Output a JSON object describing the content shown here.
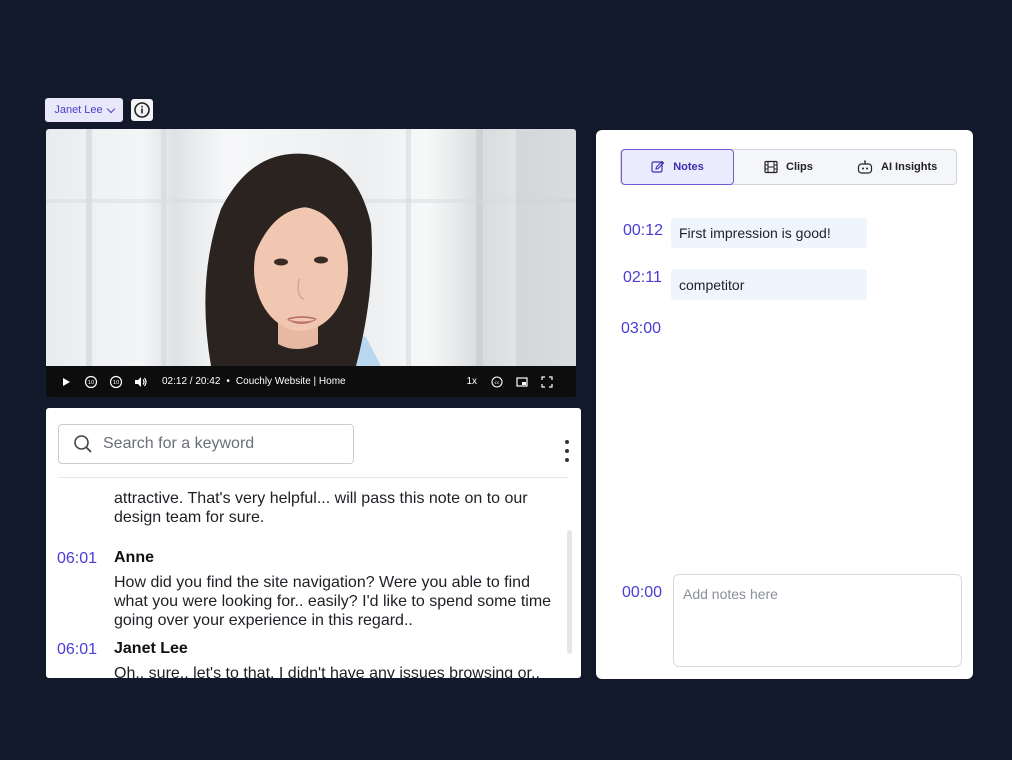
{
  "participant": {
    "name": "Janet Lee"
  },
  "video": {
    "current_time": "02:12",
    "duration": "20:42",
    "source": "Couchly Website | Home",
    "speed": "1x",
    "progress": 0.1063
  },
  "transcript": {
    "search_placeholder": "Search for a keyword",
    "entries": [
      {
        "time": "",
        "speaker": "",
        "text": [
          "attractive. That's very helpful... will pass this note on to our",
          "design team for sure."
        ]
      },
      {
        "time": "06:01",
        "speaker": "Anne",
        "text": [
          "How did you find the site navigation? Were you able to find",
          "what you were looking for.. easily? I'd like to spend some time",
          "going over your experience in this regard.."
        ]
      },
      {
        "time": "06:01",
        "speaker": "Janet Lee",
        "text": [
          "Oh.. sure.. let's to that. I didn't have any issues browsing or.."
        ]
      }
    ]
  },
  "notes": {
    "tabs": [
      {
        "label": "Notes",
        "icon": "edit-icon",
        "active": true
      },
      {
        "label": "Clips",
        "icon": "film-icon",
        "active": false
      },
      {
        "label": "AI Insights",
        "icon": "robot-icon",
        "active": false
      }
    ],
    "items": [
      {
        "time": "00:12",
        "text": "First impression is good!"
      },
      {
        "time": "02:11",
        "text": "competitor"
      },
      {
        "time": "03:00",
        "text": ""
      }
    ],
    "input": {
      "time": "00:00",
      "placeholder": "Add notes here"
    }
  },
  "colors": {
    "background": "#12192a",
    "accent": "#4a3cd4",
    "note_chip": "#eef5fc"
  }
}
